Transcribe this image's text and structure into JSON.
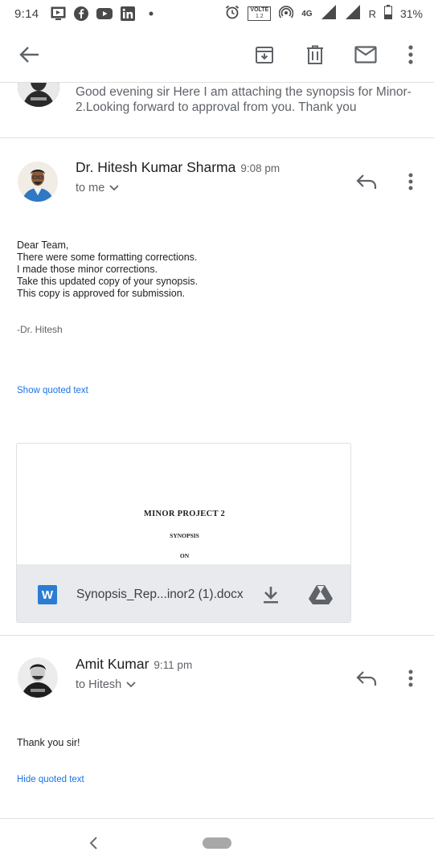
{
  "status_bar": {
    "time": "9:14",
    "volte_label": "VOLTE",
    "volte_sub": "1 2",
    "network": "4G",
    "roaming": "R",
    "battery": "31%"
  },
  "toolbar": {
    "icons": [
      "back-arrow-icon",
      "archive-icon",
      "delete-icon",
      "mark-unread-icon",
      "more-vert-icon"
    ]
  },
  "thread": {
    "collapsed_message": {
      "snippet": "Good evening sir Here I am attaching the synopsis for Minor-2.Looking forward to approval from you. Thank you"
    },
    "messages": [
      {
        "sender": "Dr. Hitesh Kumar Sharma",
        "time": "9:08 pm",
        "recipient": "to me",
        "body_lines": [
          "Dear Team,",
          "There were some formatting corrections.",
          "I made those minor corrections.",
          "Take this updated copy of your synopsis.",
          "This copy is approved for submission."
        ],
        "signature": "-Dr. Hitesh",
        "quoted_toggle": "Show quoted text",
        "attachment": {
          "preview_title": "MINOR PROJECT 2",
          "preview_line1": "SYNOPSIS",
          "preview_line2": "ON",
          "file_name": "Synopsis_Rep...inor2 (1).docx",
          "file_type_letter": "W"
        }
      },
      {
        "sender": "Amit Kumar",
        "time": "9:11 pm",
        "recipient": "to Hitesh",
        "body_lines": [
          "Thank you sir!"
        ],
        "quoted_toggle": "Hide quoted text"
      }
    ]
  },
  "colors": {
    "link": "#1a73e8",
    "word_blue": "#2b7cd3",
    "text_primary": "#202124",
    "text_secondary": "#5f6368"
  }
}
